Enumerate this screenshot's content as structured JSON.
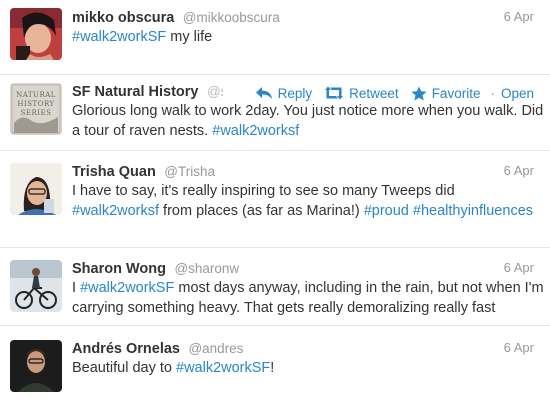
{
  "tweets": [
    {
      "name": "mikko obscura",
      "handle": "@mikkoobscura",
      "date": "6 Apr",
      "text": [
        {
          "t": "#walk2workSF",
          "tag": true
        },
        {
          "t": " my life",
          "tag": false
        }
      ]
    },
    {
      "name": "SF Natural History",
      "handle": "@sfn",
      "date": "",
      "actions": {
        "reply": "Reply",
        "retweet": "Retweet",
        "favorite": "Favorite",
        "open": "Open"
      },
      "avatar_text": [
        "NATURAL",
        "HISTORY",
        "SERIES"
      ],
      "text": [
        {
          "t": "Glorious long walk to work 2day. You just notice more when you walk. Did a tour of raven nests. ",
          "tag": false
        },
        {
          "t": "#walk2worksf",
          "tag": true
        }
      ]
    },
    {
      "name": "Trisha Quan",
      "handle": "@Trisha",
      "date": "6 Apr",
      "text": [
        {
          "t": "I have to say, it's really inspiring to see so many Tweeps did ",
          "tag": false
        },
        {
          "t": "#walk2worksf",
          "tag": true
        },
        {
          "t": " from places (as far as Marina!) ",
          "tag": false
        },
        {
          "t": "#proud",
          "tag": true
        },
        {
          "t": " ",
          "tag": false
        },
        {
          "t": "#healthyinfluences",
          "tag": true
        }
      ]
    },
    {
      "name": "Sharon Wong",
      "handle": "@sharonw",
      "date": "6 Apr",
      "text": [
        {
          "t": "I ",
          "tag": false
        },
        {
          "t": "#walk2workSF",
          "tag": true
        },
        {
          "t": " most days anyway, including in the rain, but not when I'm carrying something heavy. That gets really demoralizing really fast",
          "tag": false
        }
      ]
    },
    {
      "name": "Andrés Ornelas",
      "handle": "@andres",
      "date": "6 Apr",
      "text": [
        {
          "t": "Beautiful day to ",
          "tag": false
        },
        {
          "t": "#walk2workSF",
          "tag": true
        },
        {
          "t": "!",
          "tag": false
        }
      ]
    }
  ],
  "colors": {
    "hashtag": "#2a86c8",
    "name": "#333333",
    "muted": "#999999"
  },
  "icons": {
    "reply": "reply-arrow-icon",
    "retweet": "retweet-icon",
    "favorite": "star-icon"
  }
}
